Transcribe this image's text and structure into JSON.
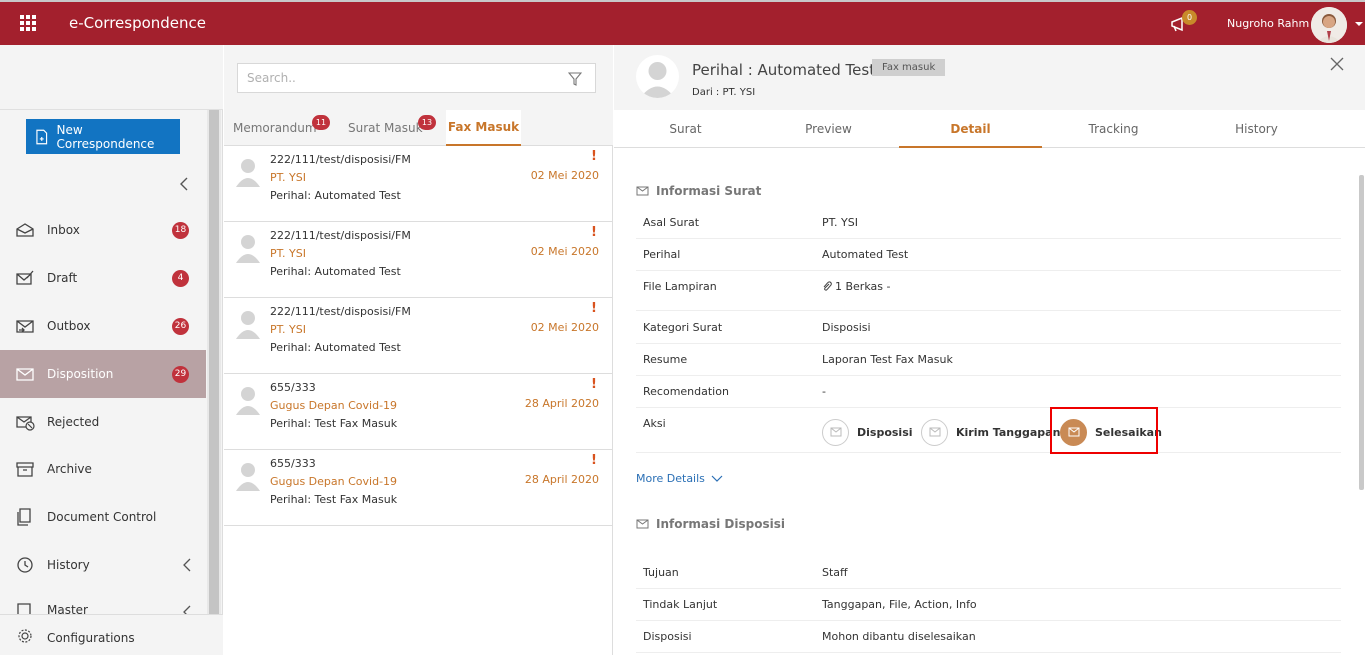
{
  "app": {
    "title": "e-Correspondence",
    "notification_count": "0",
    "user_name": "Nugroho Rahm"
  },
  "sidebar": {
    "new_button_label": "New Correspondence",
    "items": [
      {
        "label": "Inbox",
        "badge": "18",
        "icon": "inbox-icon"
      },
      {
        "label": "Draft",
        "badge": "4",
        "icon": "draft-icon"
      },
      {
        "label": "Outbox",
        "badge": "26",
        "icon": "outbox-icon"
      },
      {
        "label": "Disposition",
        "badge": "29",
        "icon": "disposition-icon"
      },
      {
        "label": "Rejected",
        "badge": "",
        "icon": "rejected-icon"
      },
      {
        "label": "Archive",
        "badge": "",
        "icon": "archive-icon"
      },
      {
        "label": "Document Control",
        "badge": "",
        "icon": "document-control-icon"
      },
      {
        "label": "History",
        "badge": "",
        "icon": "history-icon"
      },
      {
        "label": "Master",
        "badge": "",
        "icon": "master-icon"
      }
    ],
    "config_label": "Configurations"
  },
  "list": {
    "search_placeholder": "Search..",
    "tabs": [
      {
        "label": "Memorandum",
        "badge": "11"
      },
      {
        "label": "Surat Masuk",
        "badge": "13"
      },
      {
        "label": "Fax Masuk",
        "badge": ""
      }
    ],
    "items": [
      {
        "number": "222/111/test/disposisi/FM",
        "from": "PT. YSI",
        "subject": "Perihal: Automated Test",
        "date": "02 Mei 2020",
        "urgent": "!"
      },
      {
        "number": "222/111/test/disposisi/FM",
        "from": "PT. YSI",
        "subject": "Perihal: Automated Test",
        "date": "02 Mei 2020",
        "urgent": "!"
      },
      {
        "number": "222/111/test/disposisi/FM",
        "from": "PT. YSI",
        "subject": "Perihal: Automated Test",
        "date": "02 Mei 2020",
        "urgent": "!"
      },
      {
        "number": "655/333",
        "from": "Gugus Depan Covid-19",
        "subject": "Perihal: Test Fax Masuk",
        "date": "28 April 2020",
        "urgent": "!"
      },
      {
        "number": "655/333",
        "from": "Gugus Depan Covid-19",
        "subject": "Perihal: Test Fax Masuk",
        "date": "28 April 2020",
        "urgent": "!"
      }
    ]
  },
  "detail": {
    "title": "Perihal : Automated Test",
    "tag": "Fax masuk",
    "from": "Dari : PT. YSI",
    "tabs": [
      "Surat",
      "Preview",
      "Detail",
      "Tracking",
      "History"
    ],
    "section1_title": "Informasi Surat",
    "rows1": [
      {
        "label": "Asal Surat",
        "value": "PT. YSI"
      },
      {
        "label": "Perihal",
        "value": "Automated Test"
      },
      {
        "label": "File Lampiran",
        "value": "1 Berkas -"
      },
      {
        "label": "Kategori Surat",
        "value": "Disposisi"
      },
      {
        "label": "Resume",
        "value": "Laporan Test Fax Masuk"
      },
      {
        "label": "Recomendation",
        "value": "-"
      },
      {
        "label": "Aksi",
        "value": ""
      }
    ],
    "actions": [
      "Disposisi",
      "Kirim Tanggapan",
      "Selesaikan"
    ],
    "more_details": "More Details",
    "section2_title": "Informasi Disposisi",
    "rows2": [
      {
        "label": "Tujuan",
        "value": "Staff"
      },
      {
        "label": "Tindak Lanjut",
        "value": "Tanggapan, File, Action, Info"
      },
      {
        "label": "Disposisi",
        "value": "Mohon dibantu diselesaikan"
      }
    ]
  },
  "colors": {
    "brand": "#a3202d",
    "accent": "#c8762a",
    "primary_button": "#1274c2"
  }
}
